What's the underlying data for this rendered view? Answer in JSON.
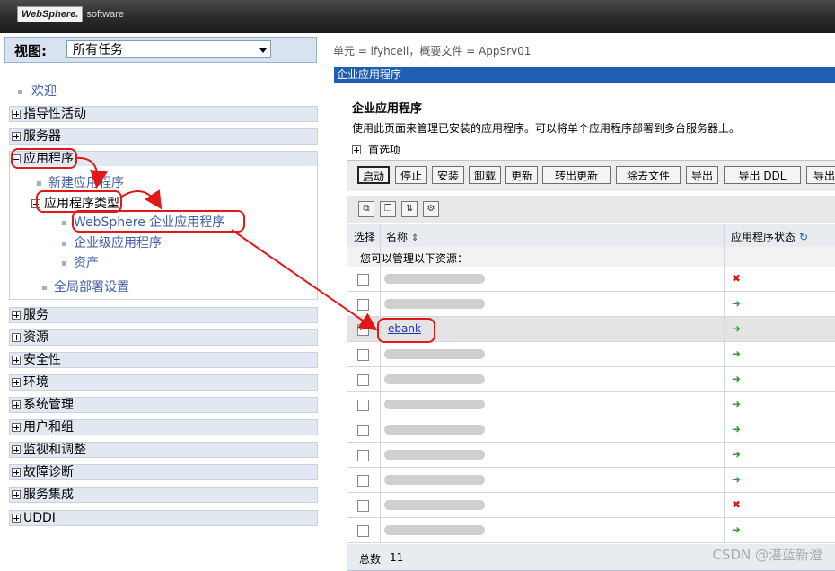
{
  "header": {
    "logo_main": "WebSphere.",
    "logo_sub": "software"
  },
  "view": {
    "label": "视图:",
    "selected": "所有任务"
  },
  "nav": {
    "welcome": "欢迎",
    "items_top": [
      "指导性活动",
      "服务器"
    ],
    "applications": {
      "label": "应用程序",
      "new_app": "新建应用程序",
      "app_types": "应用程序类型",
      "websphere_apps": "WebSphere 企业应用程序",
      "enterprise_apps": "企业级应用程序",
      "assets": "资产",
      "global_deploy": "全局部署设置"
    },
    "items_bottom": [
      "服务",
      "资源",
      "安全性",
      "环境",
      "系统管理",
      "用户和组",
      "监视和调整",
      "故障诊断",
      "服务集成",
      "UDDI"
    ]
  },
  "crumb": "单元 = lfyhcell，概要文件 = AppSrv01",
  "panel": {
    "title_bar": "企业应用程序",
    "title": "企业应用程序",
    "desc": "使用此页面来管理已安装的应用程序。可以将单个应用程序部署到多台服务器上。",
    "prefs": "首选项"
  },
  "buttons": [
    "启动",
    "停止",
    "安装",
    "卸载",
    "更新",
    "转出更新",
    "除去文件",
    "导出",
    "导出 DDL",
    "导出"
  ],
  "table": {
    "col_select": "选择",
    "col_name": "名称",
    "col_status": "应用程序状态",
    "manage_text": "您可以管理以下资源：",
    "rows": [
      {
        "name": "",
        "status": "stopped",
        "checked": false
      },
      {
        "name": "",
        "status": "started",
        "checked": false
      },
      {
        "name": "ebank",
        "status": "started",
        "checked": true
      },
      {
        "name": "",
        "status": "started",
        "checked": false
      },
      {
        "name": "",
        "status": "started",
        "checked": false
      },
      {
        "name": "",
        "status": "started",
        "checked": false
      },
      {
        "name": "",
        "status": "started",
        "checked": false
      },
      {
        "name": "",
        "status": "started",
        "checked": false
      },
      {
        "name": "",
        "status": "started",
        "checked": false
      },
      {
        "name": "",
        "status": "stopped",
        "checked": false
      },
      {
        "name": "",
        "status": "started",
        "checked": false
      }
    ],
    "total_label": "总数",
    "total_value": "11"
  },
  "watermark": "CSDN @湛蓝新澄"
}
